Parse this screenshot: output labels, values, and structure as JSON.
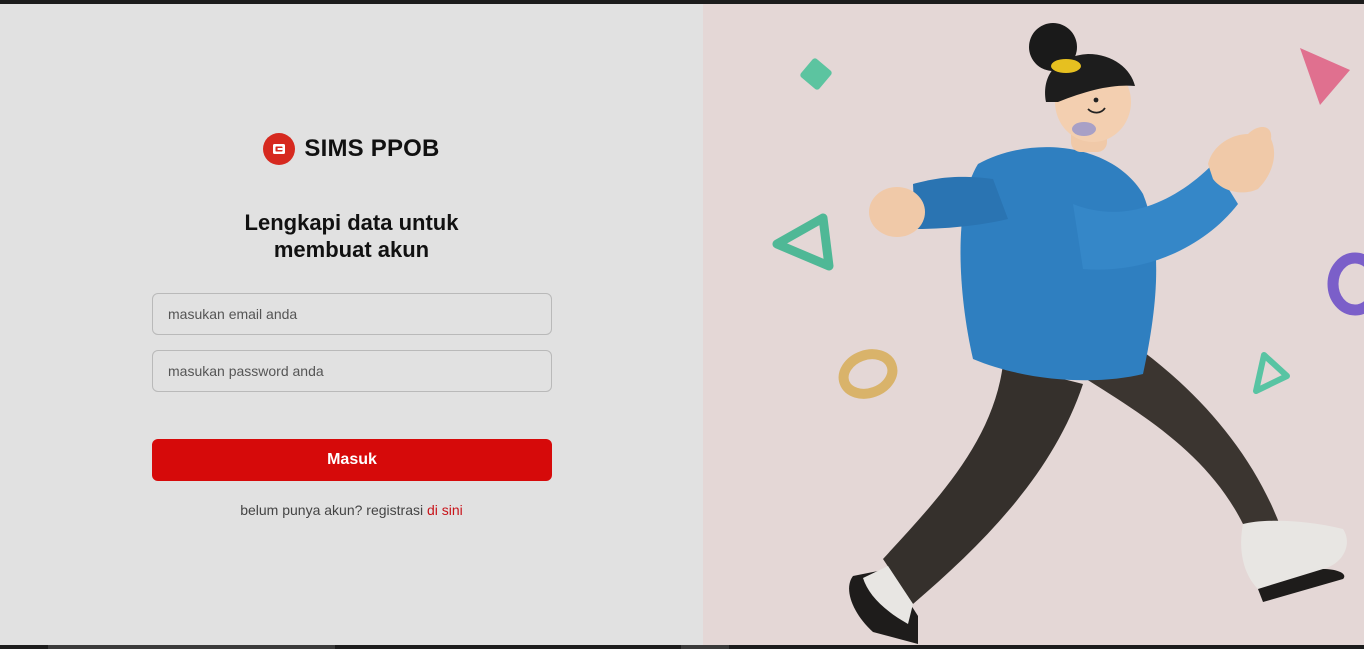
{
  "brand": {
    "name": "SIMS PPOB",
    "color": "#d6291f"
  },
  "form": {
    "heading_line1": "Lengkapi data untuk",
    "heading_line2": "membuat akun",
    "email_placeholder": "masukan email anda",
    "password_placeholder": "masukan password anda",
    "submit_label": "Masuk",
    "register_prompt": "belum punya akun? registrasi ",
    "register_link": "di sini"
  },
  "colors": {
    "primary_button": "#d60a0a",
    "link": "#c8141a",
    "left_background": "#e1e1e1",
    "right_background": "#e4d7d6"
  },
  "illustration": {
    "subject": "walking-person-illustration"
  }
}
